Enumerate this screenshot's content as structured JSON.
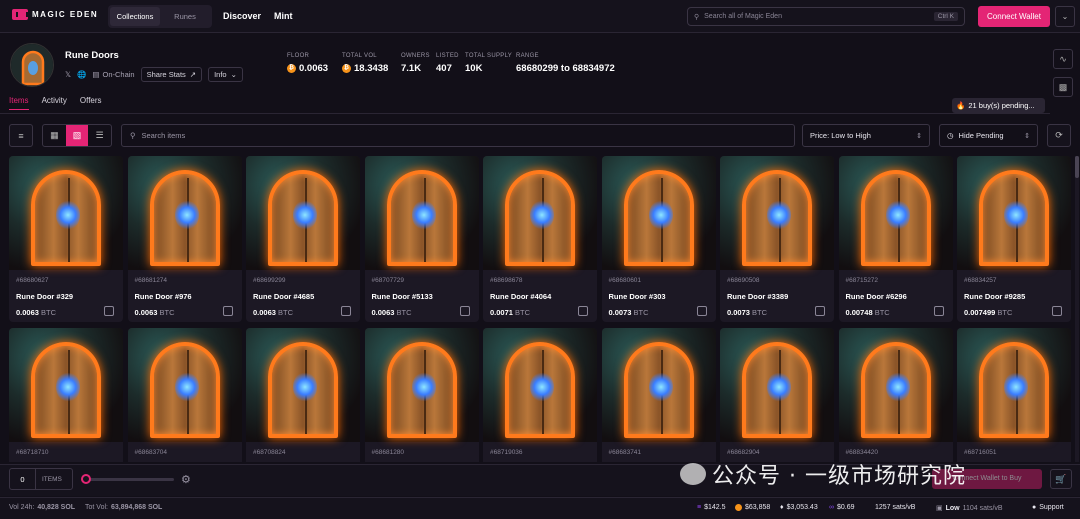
{
  "topnav": {
    "logo_text": "MAGIC EDEN",
    "seg_collections": "Collections",
    "seg_runes": "Runes",
    "discover": "Discover",
    "mint": "Mint",
    "search_placeholder": "Search all of Magic Eden",
    "shortcut": "Ctrl K",
    "connect_label": "Connect Wallet"
  },
  "collection": {
    "name": "Rune Doors",
    "onchain": "On-Chain",
    "share_stats": "Share Stats",
    "info": "Info",
    "stats": [
      {
        "label": "FLOOR",
        "value": "0.0063",
        "btc": true
      },
      {
        "label": "TOTAL VOL",
        "value": "18.3438",
        "btc": true
      },
      {
        "label": "OWNERS",
        "value": "7.1K",
        "btc": false
      },
      {
        "label": "LISTED",
        "value": "407",
        "btc": false
      },
      {
        "label": "TOTAL SUPPLY",
        "value": "10K",
        "btc": false
      },
      {
        "label": "RANGE",
        "value": "68680299 to 68834972",
        "btc": false
      }
    ]
  },
  "tabs": {
    "items": "Items",
    "activity": "Activity",
    "offers": "Offers"
  },
  "pending": "21 buy(s) pending...",
  "toolbar": {
    "search_placeholder": "Search items",
    "sort_value": "Price: Low to High",
    "pending_filter": "Hide Pending"
  },
  "items_row1": [
    {
      "id": "#68680627",
      "name": "Rune Door #329",
      "price": "0.0063",
      "unit": "BTC"
    },
    {
      "id": "#68681274",
      "name": "Rune Door #976",
      "price": "0.0063",
      "unit": "BTC"
    },
    {
      "id": "#68699299",
      "name": "Rune Door #4685",
      "price": "0.0063",
      "unit": "BTC"
    },
    {
      "id": "#68707729",
      "name": "Rune Door #5133",
      "price": "0.0063",
      "unit": "BTC"
    },
    {
      "id": "#68698678",
      "name": "Rune Door #4064",
      "price": "0.0071",
      "unit": "BTC"
    },
    {
      "id": "#68680601",
      "name": "Rune Door #303",
      "price": "0.0073",
      "unit": "BTC"
    },
    {
      "id": "#68690508",
      "name": "Rune Door #3389",
      "price": "0.0073",
      "unit": "BTC"
    },
    {
      "id": "#68715272",
      "name": "Rune Door #6296",
      "price": "0.00748",
      "unit": "BTC"
    },
    {
      "id": "#68834257",
      "name": "Rune Door #9285",
      "price": "0.007499",
      "unit": "BTC"
    }
  ],
  "items_row2": [
    {
      "id": "#68718710"
    },
    {
      "id": "#68683704"
    },
    {
      "id": "#68708824"
    },
    {
      "id": "#68681280"
    },
    {
      "id": "#68719036"
    },
    {
      "id": "#68683741"
    },
    {
      "id": "#68682904"
    },
    {
      "id": "#68834420"
    },
    {
      "id": "#68716051"
    }
  ],
  "bottom": {
    "qty": "0",
    "qty_unit": "ITEMS",
    "buy_label": "Connect Wallet to Buy",
    "watermark": "公众号 · 一级市场研究院"
  },
  "footer": {
    "vol_label": "Vol 24h:",
    "vol_value": "40,828 SOL",
    "tot_label": "Tot Vol:",
    "tot_value": "63,894,868 SOL",
    "sol_price": "$142.5",
    "btc_price": "$63,858",
    "eth_price": "$3,053.43",
    "matic_price": "$0.69",
    "fee": "1257 sats/vB",
    "low_label": "Low",
    "low_value": "1104 sats/vB",
    "support": "Support"
  }
}
